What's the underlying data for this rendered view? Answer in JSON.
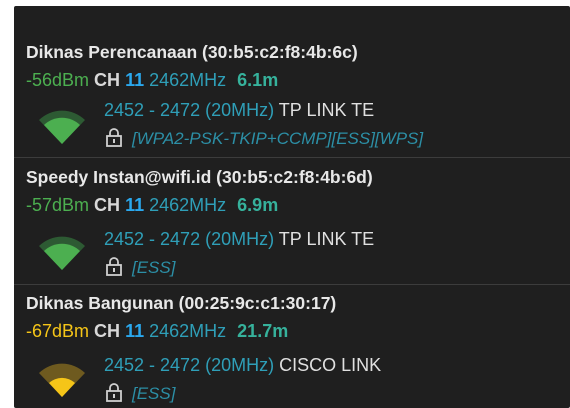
{
  "colors": {
    "background": "#1f1f1f",
    "signal_green": "#4caf50",
    "signal_yellow": "#f5c518",
    "channel_blue": "#2aa8ee",
    "frequency_teal": "#2f9fb8",
    "distance_teal": "#36b29c"
  },
  "networks": [
    {
      "title": "Diknas Perencanaan (30:b5:c2:f8:4b:6c)",
      "dbm": "-56dBm",
      "dbm_color": "#4caf50",
      "ch_label": "CH",
      "channel": "11",
      "frequency": "2462MHz",
      "distance": "6.1m",
      "range": "2452 - 2472 (20MHz)",
      "vendor": "TP LINK TE",
      "security": "[WPA2-PSK-TKIP+CCMP][ESS][WPS]",
      "signal_icon": "wifi-signal-icon",
      "lock_icon": "lock-icon",
      "signal_level": 0.75
    },
    {
      "title": "Speedy Instan@wifi.id (30:b5:c2:f8:4b:6d)",
      "dbm": "-57dBm",
      "dbm_color": "#4caf50",
      "ch_label": "CH",
      "channel": "11",
      "frequency": "2462MHz",
      "distance": "6.9m",
      "range": "2452 - 2472 (20MHz)",
      "vendor": "TP LINK TE",
      "security": "[ESS]",
      "signal_icon": "wifi-signal-icon",
      "lock_icon": "lock-icon",
      "signal_level": 0.75
    },
    {
      "title": "Diknas Bangunan (00:25:9c:c1:30:17)",
      "dbm": "-67dBm",
      "dbm_color": "#f5c518",
      "ch_label": "CH",
      "channel": "11",
      "frequency": "2462MHz",
      "distance": "21.7m",
      "range": "2452 - 2472 (20MHz)",
      "vendor": "CISCO LINK",
      "security": "[ESS]",
      "signal_icon": "wifi-signal-icon",
      "lock_icon": "lock-icon",
      "signal_level": 0.5
    }
  ]
}
